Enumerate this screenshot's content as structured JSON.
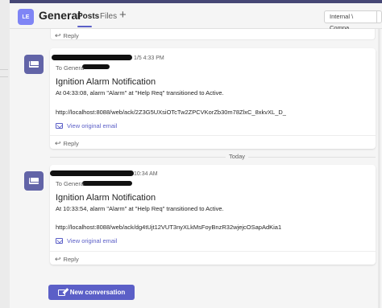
{
  "header": {
    "team_initials": "LE",
    "channel_name": "General",
    "tabs": [
      {
        "label": "Posts",
        "active": true
      },
      {
        "label": "Files",
        "active": false
      }
    ],
    "tag_label": "Internal \\ Compa..."
  },
  "reply_label": "Reply",
  "messages": [
    {
      "timestamp": "1/5 4:33 PM",
      "to": "To Genera",
      "title": "Ignition Alarm Notification",
      "body": "At 04:33:08, alarm \"Alarm\" at \"Help Req\" transitioned to Active.",
      "link": "http://localhost:8088/web/ack/2Z3G5UXsiOTcTw2ZPCVKorZb30m78ZlxC_8xkvXL_D_",
      "view_email": "View original email"
    },
    {
      "timestamp": "10:34 AM",
      "to": "To Genera",
      "title": "Ignition Alarm Notification",
      "body": "At 10:33:54, alarm \"Alarm\" at \"Help Req\" transitioned to Active.",
      "link": "http://localhost:8088/web/ack/dg4tUjt12VUT3nyXLkMsFoyBnzR32wjejcOSapAdKia1",
      "view_email": "View original email"
    }
  ],
  "day_separator": "Today",
  "new_conversation_label": "New conversation",
  "colors": {
    "accent": "#5b5fc7",
    "bot_avatar": "#6264a7",
    "team_avatar": "#7f85f5"
  }
}
